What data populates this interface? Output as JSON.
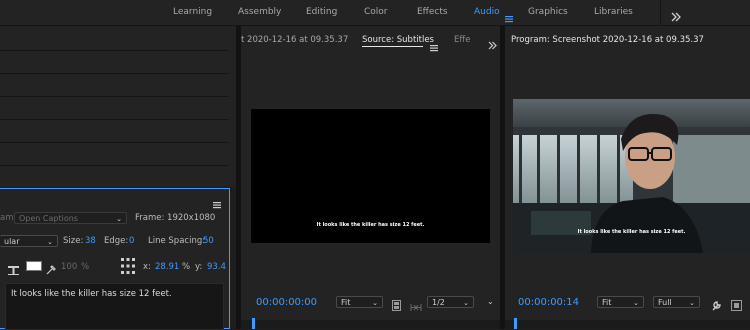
{
  "workspaces": {
    "items": [
      {
        "label": "Learning"
      },
      {
        "label": "Assembly"
      },
      {
        "label": "Editing"
      },
      {
        "label": "Color"
      },
      {
        "label": "Effects"
      },
      {
        "label": "Audio"
      },
      {
        "label": "Graphics"
      },
      {
        "label": "Libraries"
      }
    ],
    "active": "Audio",
    "overflow_icon": "double-chevron-right"
  },
  "captions_panel": {
    "stream_label": "am:",
    "stream_value": "Open Captions",
    "frame_label": "Frame: 1920x1080",
    "font_style_value": "ular",
    "size_label": "Size:",
    "size_value": "38",
    "edge_label": "Edge:",
    "edge_value": "0",
    "line_spacing_label": "Line Spacing:",
    "line_spacing_value": "50",
    "opacity_value": "100",
    "opacity_unit": "%",
    "x_label": "x:",
    "x_value": "28.91",
    "percent_symbol": "%",
    "y_label": "y:",
    "y_value": "93.4",
    "caption_text": "It looks like the killer has size 12 feet."
  },
  "source_panel": {
    "tab_prev": "t 2020-12-16 at 09.35.37",
    "tab_active": "Source: Subtitles",
    "tab_next": "Effe",
    "subtitle_text": "It looks like the killer has size 12 feet.",
    "timecode": "00:00:00:00",
    "fit_value": "Fit",
    "resolution_value": "1/2"
  },
  "program_panel": {
    "title": "Program: Screenshot 2020-12-16 at 09.35.37",
    "subtitle_text": "It looks like the killer has size 12 feet.",
    "timecode": "00:00:00:14",
    "fit_value": "Fit",
    "resolution_value": "Full"
  },
  "colors": {
    "accent": "#3f9bff",
    "panel_bg": "#232323",
    "app_bg": "#1e1e1e"
  }
}
